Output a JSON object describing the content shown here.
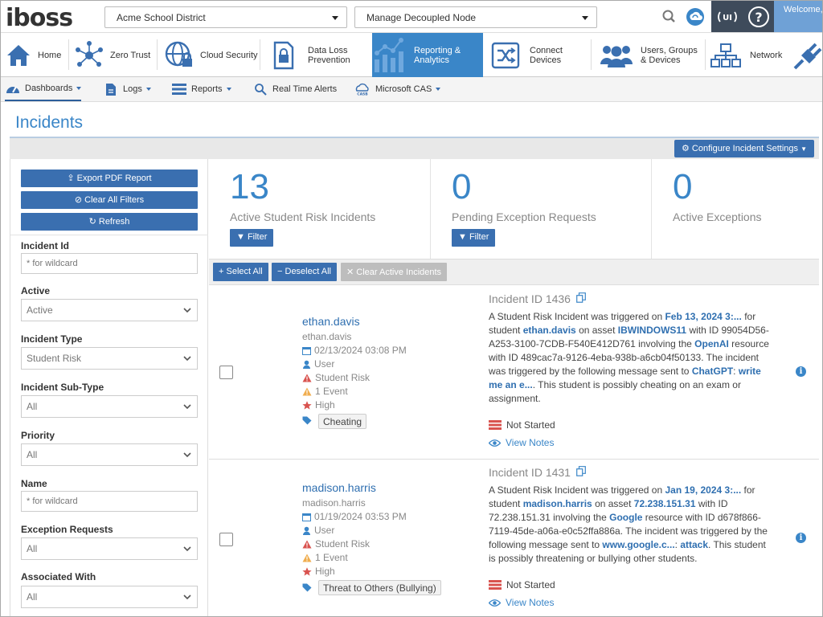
{
  "topbar": {
    "logo": "iboss",
    "district_select": "Acme School District",
    "node_select": "Manage Decoupled Node",
    "welcome": "Welcome,"
  },
  "mainnav": [
    {
      "label": "Home",
      "icon": "home-icon"
    },
    {
      "label": "Zero Trust",
      "icon": "network-nodes-icon"
    },
    {
      "label": "Cloud Security",
      "icon": "globe-lock-icon"
    },
    {
      "label": "Data Loss Prevention",
      "icon": "lock-document-icon"
    },
    {
      "label": "Reporting & Analytics",
      "icon": "chart-icon"
    },
    {
      "label": "Connect Devices",
      "icon": "shuffle-icon"
    },
    {
      "label": "Users, Groups & Devices",
      "icon": "users-icon"
    },
    {
      "label": "Network",
      "icon": "network-tree-icon"
    }
  ],
  "subnav": [
    {
      "label": "Dashboards"
    },
    {
      "label": "Logs"
    },
    {
      "label": "Reports"
    },
    {
      "label": "Real Time Alerts"
    },
    {
      "label": "Microsoft CAS"
    }
  ],
  "page": {
    "title": "Incidents",
    "configure_label": "Configure Incident Settings"
  },
  "sidebar": {
    "export_label": "Export PDF Report",
    "clear_label": "Clear All Filters",
    "refresh_label": "Refresh",
    "fields": {
      "incident_id": {
        "label": "Incident Id",
        "placeholder": "* for wildcard"
      },
      "active": {
        "label": "Active",
        "value": "Active"
      },
      "incident_type": {
        "label": "Incident Type",
        "value": "Student Risk"
      },
      "incident_subtype": {
        "label": "Incident Sub-Type",
        "value": "All"
      },
      "priority": {
        "label": "Priority",
        "value": "All"
      },
      "name": {
        "label": "Name",
        "placeholder": "* for wildcard"
      },
      "exception_requests": {
        "label": "Exception Requests",
        "value": "All"
      },
      "associated_with": {
        "label": "Associated With",
        "value": "All"
      }
    }
  },
  "stats": [
    {
      "value": "13",
      "label": "Active Student Risk Incidents",
      "filter_label": "Filter"
    },
    {
      "value": "0",
      "label": "Pending Exception Requests",
      "filter_label": "Filter"
    },
    {
      "value": "0",
      "label": "Active Exceptions"
    }
  ],
  "actions": {
    "select_all": "Select All",
    "deselect_all": "Deselect All",
    "clear_active": "Clear Active Incidents"
  },
  "incidents": [
    {
      "user": "ethan.davis",
      "user_sub": "ethan.davis",
      "datetime": "02/13/2024 03:08 PM",
      "role": "User",
      "type": "Student Risk",
      "events": "1 Event",
      "priority": "High",
      "tag": "Cheating",
      "incident_id": "Incident ID 1436",
      "desc": {
        "t1": "A Student Risk Incident was triggered on ",
        "date": "Feb 13, 2024 3:...",
        "t2": " for student ",
        "student": "ethan.davis",
        "t3": " on asset ",
        "asset": "IBWINDOWS11",
        "t4": " with ID 99054D56-A253-3100-7CDB-F540E412D761 involving the ",
        "resource": "OpenAI",
        "t5": " resource with ID 489cac7a-9126-4eba-938b-a6cb04f50133. The incident was triggered by the following message sent to ",
        "target": "ChatGPT",
        "t6": ": ",
        "message": "write me an e...",
        "t7": ". This student is possibly cheating on an exam or assignment."
      },
      "status": "Not Started",
      "notes_label": "View Notes"
    },
    {
      "user": "madison.harris",
      "user_sub": "madison.harris",
      "datetime": "01/19/2024 03:53 PM",
      "role": "User",
      "type": "Student Risk",
      "events": "1 Event",
      "priority": "High",
      "tag": "Threat to Others (Bullying)",
      "incident_id": "Incident ID 1431",
      "desc": {
        "t1": "A Student Risk Incident was triggered on ",
        "date": "Jan 19, 2024 3:...",
        "t2": " for student ",
        "student": "madison.harris",
        "t3": " on asset ",
        "asset": "72.238.151.31",
        "t4": " with ID 72.238.151.31 involving the ",
        "resource": "Google",
        "t5": " resource with ID d678f866-7119-45de-a06a-e0c52ffa886a. The incident was triggered by the following message sent to ",
        "target": "www.google.c...",
        "t6": ": ",
        "message": "attack",
        "t7": ". This student is possibly threatening or bullying other students."
      },
      "status": "Not Started",
      "notes_label": "View Notes"
    }
  ],
  "colors": {
    "accent": "#3a86c8",
    "button": "#3a6fb0",
    "active_nav": "#3a86c8",
    "dark_box": "#3e4b5b"
  }
}
